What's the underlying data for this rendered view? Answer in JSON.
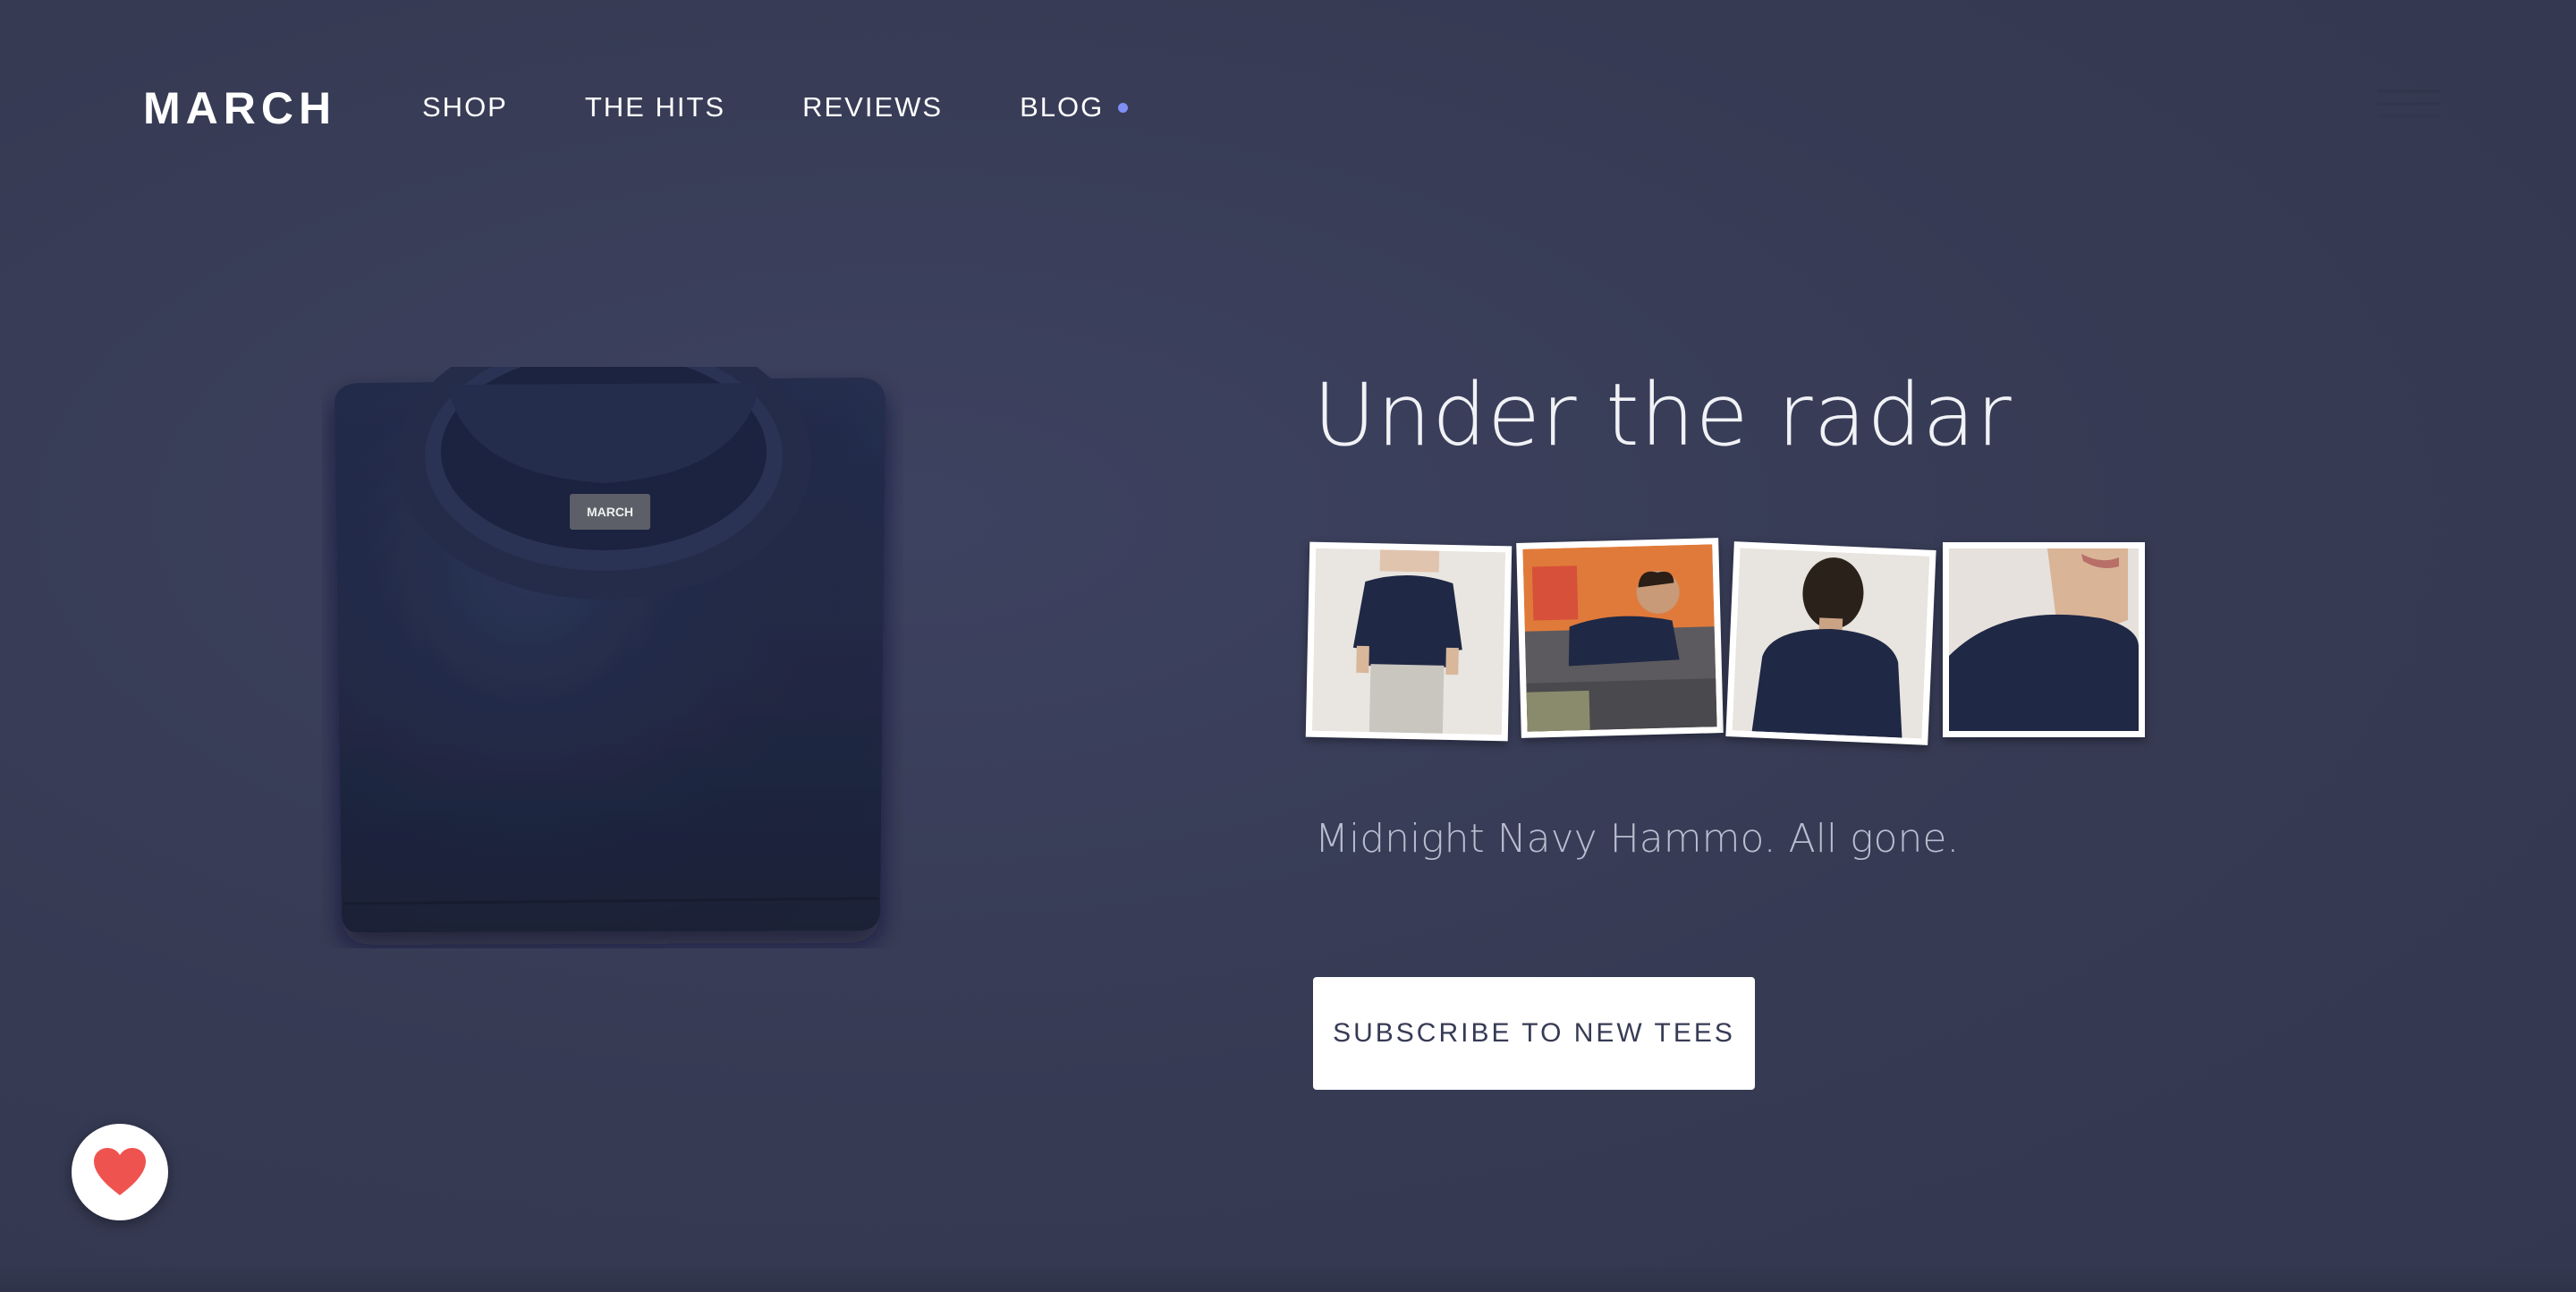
{
  "brand": {
    "logo": "MARCH",
    "label_on_tag": "MARCH"
  },
  "nav": {
    "items": [
      {
        "label": "SHOP"
      },
      {
        "label": "THE HITS"
      },
      {
        "label": "REVIEWS"
      },
      {
        "label": "BLOG"
      }
    ]
  },
  "hero": {
    "headline": "Under the radar",
    "subline": "Midnight Navy Hammo. All gone.",
    "cta_label": "SUBSCRIBE TO NEW TEES",
    "thumbnails": [
      {
        "icon": "model-front-photo"
      },
      {
        "icon": "model-couch-photo"
      },
      {
        "icon": "model-back-photo"
      },
      {
        "icon": "model-shoulder-photo"
      }
    ]
  },
  "floating": {
    "icon": "heart-icon"
  },
  "colors": {
    "background": "#373b55",
    "accent_dot": "#7f8ff5",
    "cta_bg": "#ffffff",
    "heart": "#ef5350",
    "shirt": "#1f2640"
  }
}
